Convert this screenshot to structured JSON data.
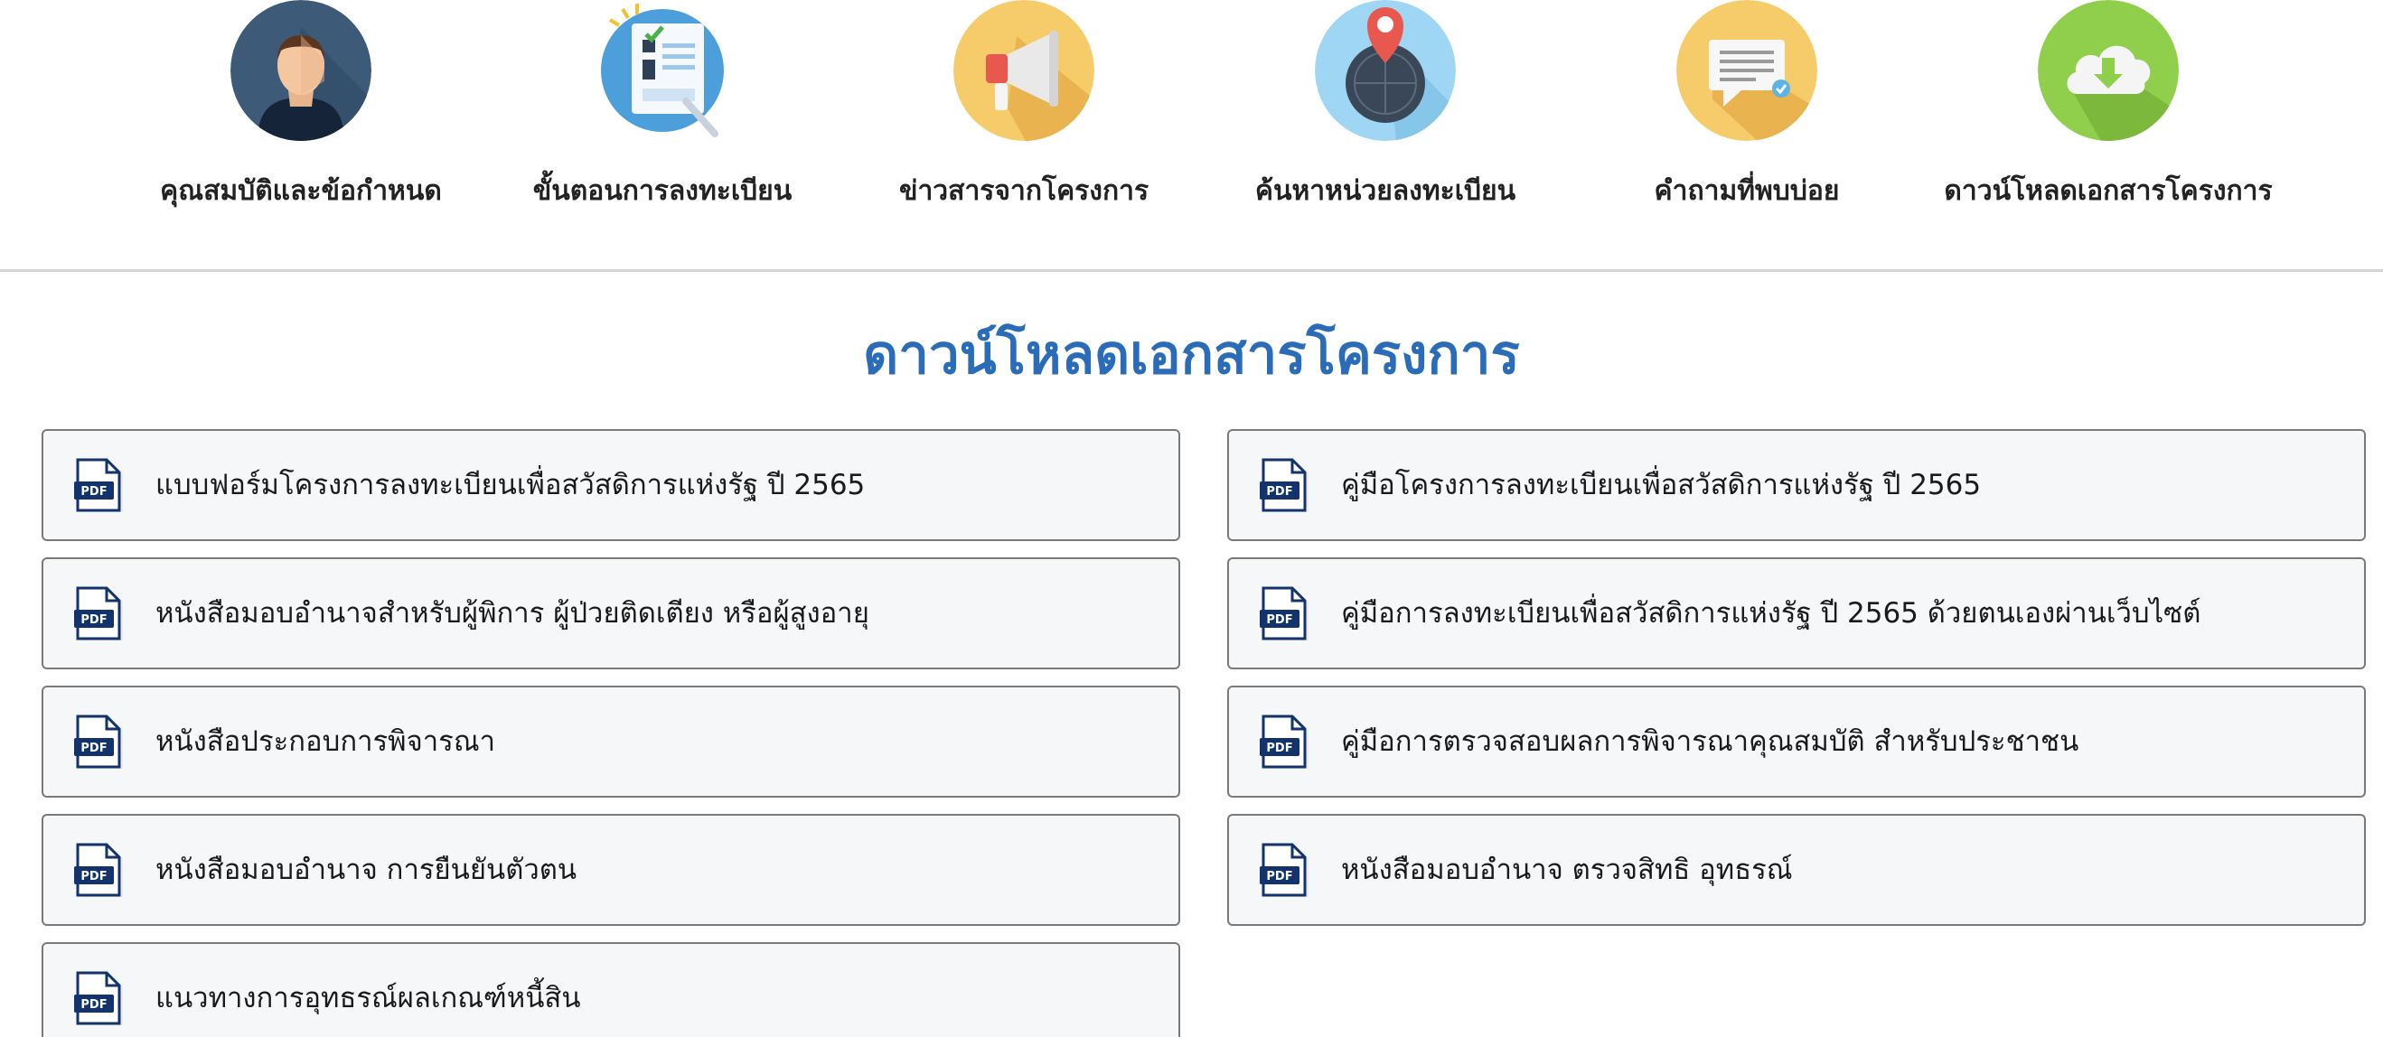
{
  "nav": {
    "items": [
      {
        "label": "คุณสมบัติและข้อกำหนด",
        "icon": "person-avatar-icon",
        "color": "#3d5a78"
      },
      {
        "label": "ขั้นตอนการลงทะเบียน",
        "icon": "registration-form-icon",
        "color": "#4d9fdb"
      },
      {
        "label": "ข่าวสารจากโครงการ",
        "icon": "megaphone-icon",
        "color": "#f6cc6b"
      },
      {
        "label": "ค้นหาหน่วยลงทะเบียน",
        "icon": "map-pin-icon",
        "color": "#9fd6f3"
      },
      {
        "label": "คำถามที่พบบ่อย",
        "icon": "chat-bubble-icon",
        "color": "#f6cc6b"
      },
      {
        "label": "ดาวน์โหลดเอกสารโครงการ",
        "icon": "cloud-download-icon",
        "color": "#8fcf4c"
      }
    ]
  },
  "section": {
    "title": "ดาวน์โหลดเอกสารโครงการ",
    "title_color": "#2b6cb8"
  },
  "documents": {
    "left": [
      {
        "label": "แบบฟอร์มโครงการลงทะเบียนเพื่อสวัสดิการแห่งรัฐ ปี 2565",
        "icon": "pdf-icon"
      },
      {
        "label": "หนังสือมอบอำนาจสำหรับผู้พิการ ผู้ป่วยติดเตียง หรือผู้สูงอายุ",
        "icon": "pdf-icon"
      },
      {
        "label": "หนังสือประกอบการพิจารณา",
        "icon": "pdf-icon"
      },
      {
        "label": "หนังสือมอบอำนาจ การยืนยันตัวตน",
        "icon": "pdf-icon"
      },
      {
        "label": "แนวทางการอุทธรณ์ผลเกณฑ์หนี้สิน",
        "icon": "pdf-icon"
      }
    ],
    "right": [
      {
        "label": "คู่มือโครงการลงทะเบียนเพื่อสวัสดิการแห่งรัฐ ปี 2565",
        "icon": "pdf-icon"
      },
      {
        "label": "คู่มือการลงทะเบียนเพื่อสวัสดิการแห่งรัฐ ปี 2565 ด้วยตนเองผ่านเว็บไซต์",
        "icon": "pdf-icon"
      },
      {
        "label": "คู่มือการตรวจสอบผลการพิจารณาคุณสมบัติ สำหรับประชาชน",
        "icon": "pdf-icon"
      },
      {
        "label": "หนังสือมอบอำนาจ ตรวจสิทธิ อุทธรณ์",
        "icon": "pdf-icon"
      }
    ],
    "pdf_badge_text": "PDF",
    "pdf_badge_color": "#12336b"
  }
}
